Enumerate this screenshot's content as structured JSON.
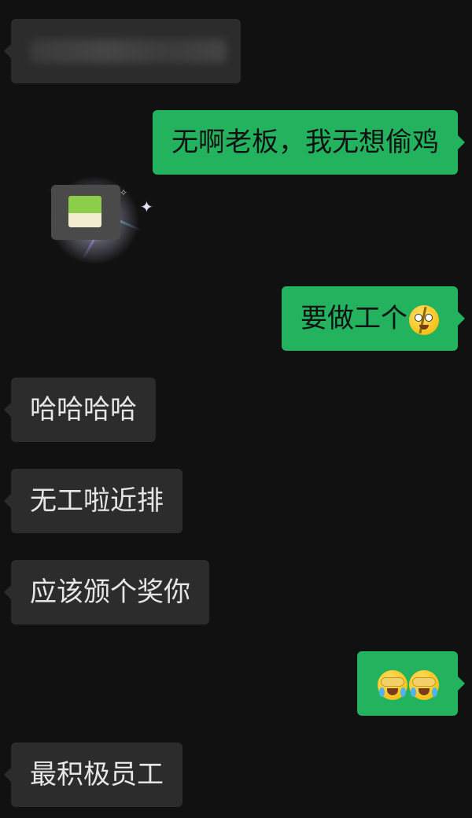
{
  "messages": [
    {
      "side": "left",
      "type": "text",
      "text": "",
      "blurred": true
    },
    {
      "side": "right",
      "type": "text",
      "text": "无啊老板，我无想偷鸡"
    },
    {
      "side": "left",
      "type": "sticker",
      "icon": "sparkle-box-sticker"
    },
    {
      "side": "right",
      "type": "text",
      "text": "要做工个",
      "emoji": "dizzy-face-emoji"
    },
    {
      "side": "left",
      "type": "text",
      "text": "哈哈哈哈"
    },
    {
      "side": "left",
      "type": "text",
      "text": "无工啦近排"
    },
    {
      "side": "left",
      "type": "text",
      "text": "应该颁个奖你"
    },
    {
      "side": "right",
      "type": "emoji",
      "emojis": [
        "facepalm-emoji",
        "facepalm-emoji"
      ]
    },
    {
      "side": "left",
      "type": "text",
      "text": "最积极员工"
    }
  ],
  "colors": {
    "background": "#111111",
    "incoming_bubble": "#2c2c2c",
    "outgoing_bubble": "#23b35f",
    "incoming_text": "#e6e6e6",
    "outgoing_text": "#111111"
  },
  "sticker": {
    "sparkle": "✦",
    "sparkle_small": "✧"
  }
}
